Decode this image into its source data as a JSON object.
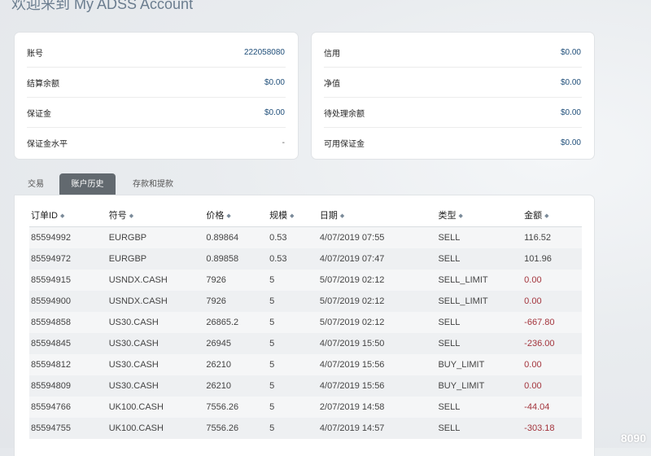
{
  "page": {
    "title": "欢迎来到 My ADSS Account"
  },
  "account_left": [
    {
      "label": "账号",
      "value": "222058080"
    },
    {
      "label": "结算余额",
      "value": "$0.00"
    },
    {
      "label": "保证金",
      "value": "$0.00"
    },
    {
      "label": "保证金水平",
      "value": "-"
    }
  ],
  "account_right": [
    {
      "label": "信用",
      "value": "$0.00"
    },
    {
      "label": "净值",
      "value": "$0.00"
    },
    {
      "label": "待处理余额",
      "value": "$0.00"
    },
    {
      "label": "可用保证金",
      "value": "$0.00"
    }
  ],
  "tabs": [
    {
      "label": "交易",
      "active": false
    },
    {
      "label": "账户历史",
      "active": true
    },
    {
      "label": "存款和提款",
      "active": false
    }
  ],
  "table": {
    "sort_icon": "sort-icon",
    "columns": [
      "订单ID",
      "符号",
      "价格",
      "规模",
      "日期",
      "类型",
      "金额"
    ],
    "rows": [
      [
        "85594992",
        "EURGBP",
        "0.89864",
        "0.53",
        "4/07/2019 07:55",
        "SELL",
        "116.52"
      ],
      [
        "85594972",
        "EURGBP",
        "0.89858",
        "0.53",
        "4/07/2019 07:47",
        "SELL",
        "101.96"
      ],
      [
        "85594915",
        "USNDX.CASH",
        "7926",
        "5",
        "5/07/2019 02:12",
        "SELL_LIMIT",
        "0.00"
      ],
      [
        "85594900",
        "USNDX.CASH",
        "7926",
        "5",
        "5/07/2019 02:12",
        "SELL_LIMIT",
        "0.00"
      ],
      [
        "85594858",
        "US30.CASH",
        "26865.2",
        "5",
        "5/07/2019 02:12",
        "SELL",
        "-667.80"
      ],
      [
        "85594845",
        "US30.CASH",
        "26945",
        "5",
        "4/07/2019 15:50",
        "SELL",
        "-236.00"
      ],
      [
        "85594812",
        "US30.CASH",
        "26210",
        "5",
        "4/07/2019 15:56",
        "BUY_LIMIT",
        "0.00"
      ],
      [
        "85594809",
        "US30.CASH",
        "26210",
        "5",
        "4/07/2019 15:56",
        "BUY_LIMIT",
        "0.00"
      ],
      [
        "85594766",
        "UK100.CASH",
        "7556.26",
        "5",
        "2/07/2019 14:58",
        "SELL",
        "-44.04"
      ],
      [
        "85594755",
        "UK100.CASH",
        "7556.26",
        "5",
        "4/07/2019 14:57",
        "SELL",
        "-303.18"
      ]
    ],
    "amount_colors": {
      "zero_or_negative": "#a3343c",
      "positive": "#444444"
    }
  },
  "watermark": "8090"
}
